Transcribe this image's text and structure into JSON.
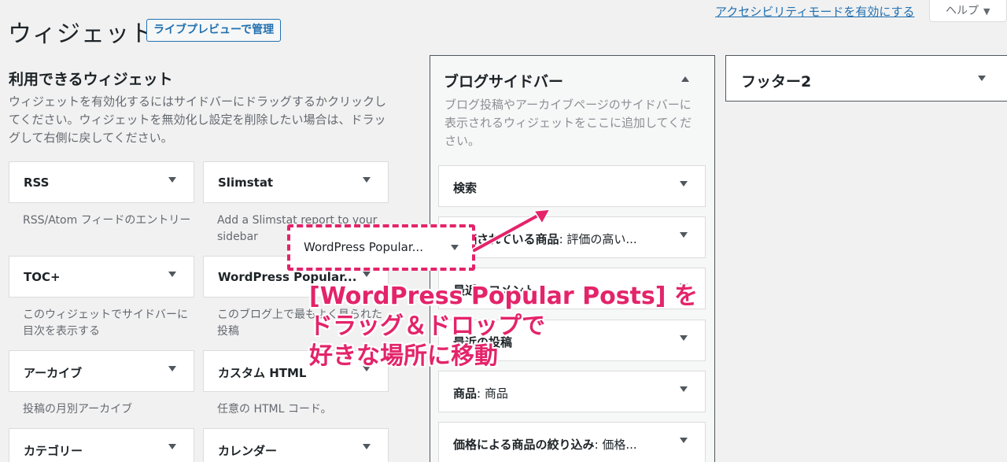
{
  "header": {
    "title": "ウィジェット",
    "live_preview_button": "ライブプレビューで管理",
    "accessibility_link": "アクセシビリティモードを有効にする",
    "help_tab": "ヘルプ"
  },
  "available": {
    "title": "利用できるウィジェット",
    "description": "ウィジェットを有効化するにはサイドバーにドラッグするかクリックしてください。ウィジェットを無効化し設定を削除したい場合は、ドラッグして右側に戻してください。",
    "widgets": [
      {
        "name": "RSS",
        "desc": "RSS/Atom フィードのエントリー"
      },
      {
        "name": "Slimstat",
        "desc": "Add a Slimstat report to your sidebar"
      },
      {
        "name": "TOC+",
        "desc": "このウィジェットでサイドバーに目次を表示する"
      },
      {
        "name": "WordPress Popular...",
        "desc": "このブログ上で最もよく見られた投稿"
      },
      {
        "name": "アーカイブ",
        "desc": "投稿の月別アーカイブ"
      },
      {
        "name": "カスタム HTML",
        "desc": "任意の HTML コード。"
      },
      {
        "name": "カテゴリー",
        "desc": ""
      },
      {
        "name": "カレンダー",
        "desc": ""
      }
    ]
  },
  "blog_sidebar": {
    "title": "ブログサイドバー",
    "description": "ブログ投稿やアーカイブページのサイドバーに表示されるウィジェットをここに追加してください。",
    "widgets": [
      {
        "name": "検索",
        "suffix": ""
      },
      {
        "name": "評価されている商品",
        "suffix": ": 評価の高い..."
      },
      {
        "name": "最近のコメント",
        "suffix": ""
      },
      {
        "name": "最近の投稿",
        "suffix": ""
      },
      {
        "name": "商品",
        "suffix": ": 商品"
      },
      {
        "name": "価格による商品の絞り込み",
        "suffix": ": 価格..."
      }
    ]
  },
  "footer2": {
    "title": "フッター2"
  },
  "drag_ghost": {
    "label": "WordPress Popular..."
  },
  "annotation": {
    "line1": "[WordPress Popular Posts] を",
    "line2": "ドラッグ＆ドロップで",
    "line3": "好きな場所に移動"
  },
  "colors": {
    "accent_pink": "#e3246a",
    "link_blue": "#2271b1",
    "background": "#f1f1f1"
  }
}
